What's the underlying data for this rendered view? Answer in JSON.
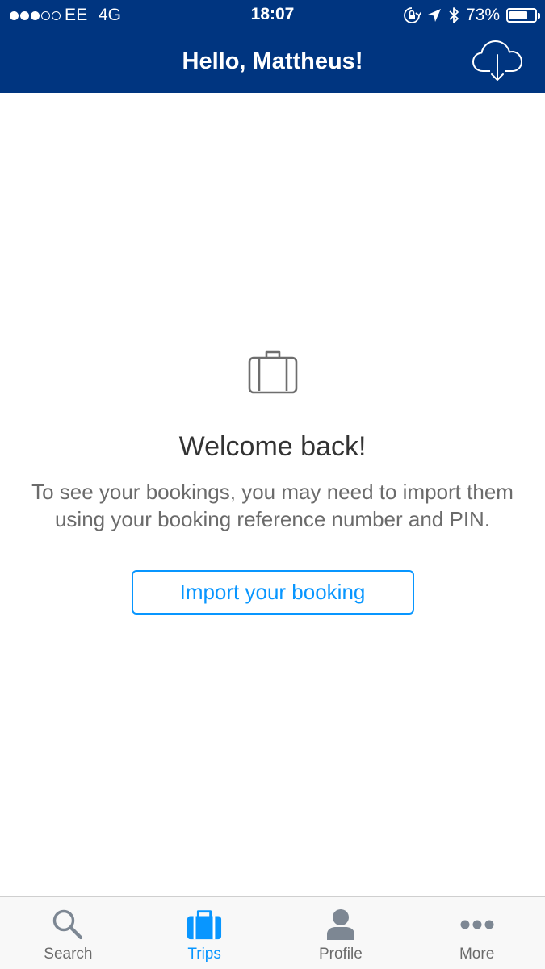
{
  "status_bar": {
    "carrier": "EE",
    "network": "4G",
    "time": "18:07",
    "battery_percent": "73%",
    "battery_level": 0.73,
    "signal_bars_filled": 3,
    "signal_bars_total": 5
  },
  "header": {
    "title": "Hello, Mattheus!",
    "action_icon": "cloud-download-icon"
  },
  "empty_state": {
    "icon": "suitcase-icon",
    "title": "Welcome back!",
    "message": "To see your bookings, you may need to import them using your booking reference number and PIN.",
    "button_label": "Import your booking"
  },
  "tab_bar": {
    "tabs": [
      {
        "label": "Search",
        "icon": "search-icon",
        "active": false
      },
      {
        "label": "Trips",
        "icon": "suitcase-icon",
        "active": true
      },
      {
        "label": "Profile",
        "icon": "person-icon",
        "active": false
      },
      {
        "label": "More",
        "icon": "more-icon",
        "active": false
      }
    ]
  },
  "colors": {
    "brand_blue": "#003580",
    "accent_blue": "#0896ff",
    "inactive_tab": "#6b6b6b",
    "icon_gray": "#7d8793"
  }
}
